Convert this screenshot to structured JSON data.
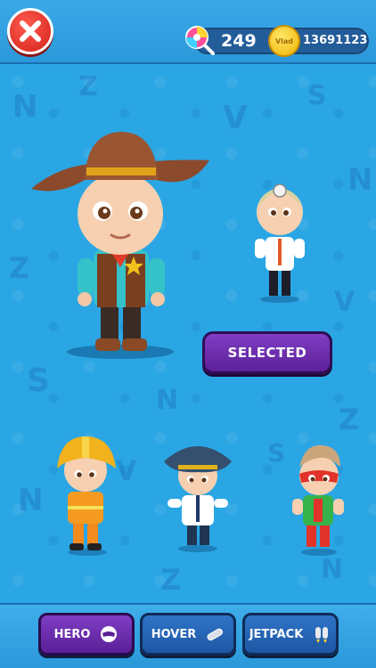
{
  "header": {
    "candies": "249",
    "coins": "13691123",
    "coin_label": "Vlad"
  },
  "main": {
    "selected_label": "SELECTED",
    "characters": [
      {
        "name": "cowboy",
        "selected": true
      },
      {
        "name": "doctor",
        "selected": false
      },
      {
        "name": "firefighter",
        "selected": false
      },
      {
        "name": "pilot",
        "selected": false
      },
      {
        "name": "superhero",
        "selected": false
      }
    ]
  },
  "tabs": [
    {
      "label": "HERO",
      "icon": "hero-mask-icon",
      "active": true
    },
    {
      "label": "HOVER",
      "icon": "hoverboard-icon",
      "active": false
    },
    {
      "label": "JETPACK",
      "icon": "jetpack-icon",
      "active": false
    }
  ],
  "colors": {
    "background": "#2aa6e4",
    "accent_purple": "#6a2cae",
    "tab_blue": "#2466b5",
    "close_red": "#e2332a"
  }
}
